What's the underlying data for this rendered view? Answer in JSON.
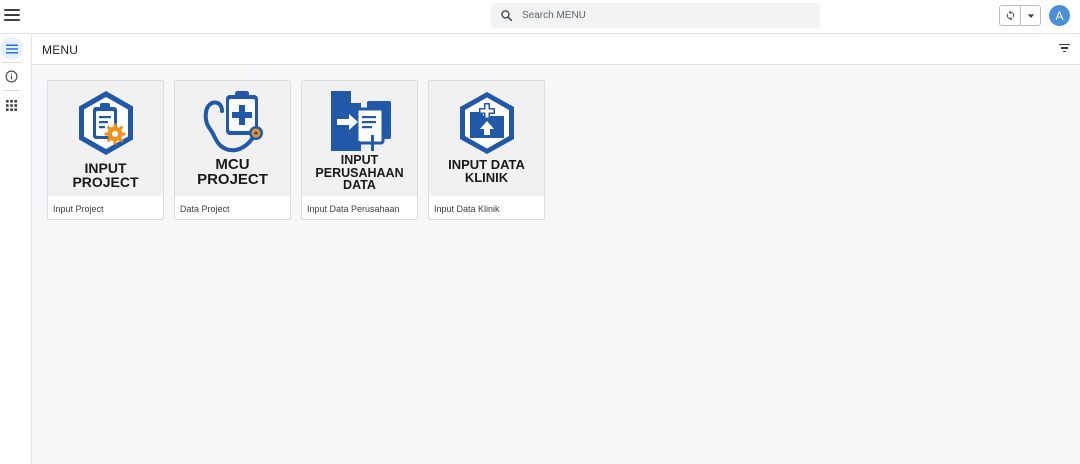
{
  "search": {
    "placeholder": "Search MENU"
  },
  "avatar": {
    "initial": "A"
  },
  "page": {
    "title": "MENU"
  },
  "colors": {
    "brand_blue": "#2158a8",
    "accent_orange": "#f0931e",
    "avatar_bg": "#4a8fd8"
  },
  "cards": [
    {
      "thumb_title": "INPUT PROJECT",
      "caption": "Input Project",
      "icon": "clipboard-gear-icon"
    },
    {
      "thumb_title": "MCU PROJECT",
      "caption": "Data Project",
      "icon": "stethoscope-clipboard-icon"
    },
    {
      "thumb_title": "INPUT PERUSAHAAN DATA",
      "caption": "Input Data Perusahaan",
      "icon": "building-document-icon"
    },
    {
      "thumb_title": "INPUT DATA KLINIK",
      "caption": "Input Data Klinik",
      "icon": "clinic-folder-upload-icon"
    }
  ]
}
